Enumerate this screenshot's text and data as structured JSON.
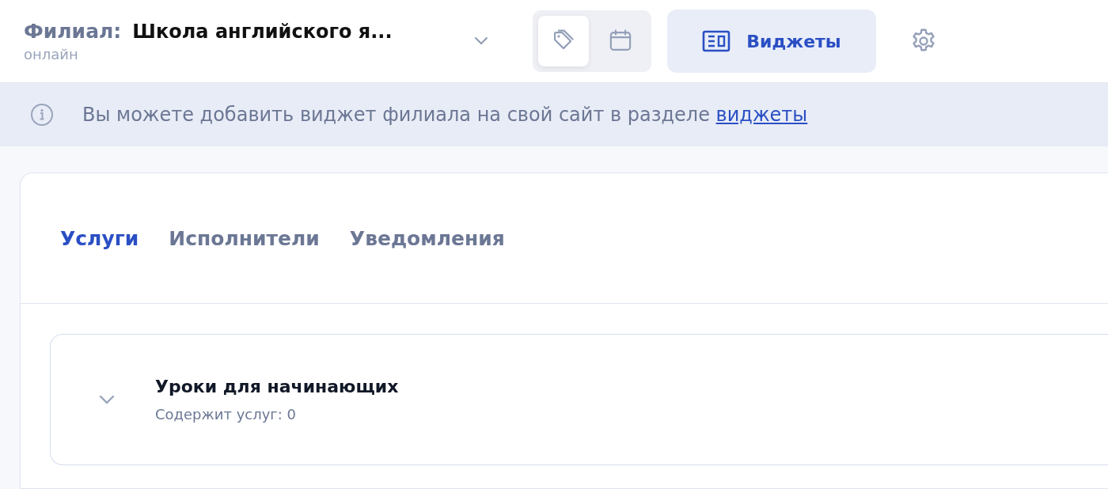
{
  "header": {
    "branch_label": "Филиал:",
    "branch_name": "Школа английского я...",
    "branch_mode": "онлайн",
    "view_toggle": [
      {
        "kind": "tags",
        "selected": true
      },
      {
        "kind": "calendar",
        "selected": false
      }
    ],
    "widgets_button": "Виджеты"
  },
  "banner": {
    "text": "Вы можете добавить виджет филиала на свой сайт в разделе ",
    "link": "виджеты"
  },
  "tabs": [
    {
      "label": "Услуги",
      "selected": true
    },
    {
      "label": "Исполнители",
      "selected": false
    },
    {
      "label": "Уведомления",
      "selected": false
    }
  ],
  "groups": [
    {
      "title": "Уроки для начинающих",
      "subtitle": "Содержит услуг: 0",
      "expanded": false
    }
  ]
}
